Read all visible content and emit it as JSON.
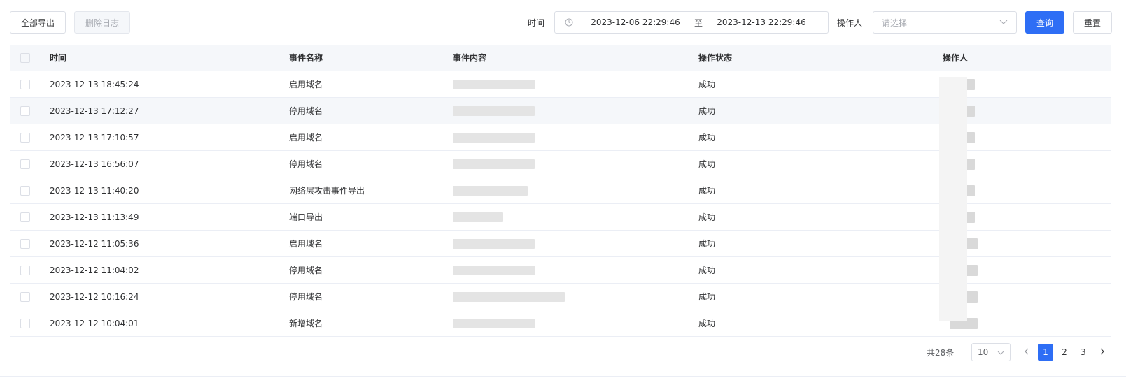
{
  "toolbar": {
    "export_all_label": "全部导出",
    "delete_log_label": "删除日志",
    "time_label": "时间",
    "date_start": "2023-12-06 22:29:46",
    "date_separator": "至",
    "date_end": "2023-12-13 22:29:46",
    "operator_label": "操作人",
    "operator_placeholder": "请选择",
    "query_label": "查询",
    "reset_label": "重置"
  },
  "table": {
    "headers": {
      "time": "时间",
      "event_name": "事件名称",
      "event_content": "事件内容",
      "status": "操作状态",
      "operator": "操作人"
    },
    "rows": [
      {
        "time": "2023-12-13 18:45:24",
        "event_name": "启用域名",
        "status": "成功"
      },
      {
        "time": "2023-12-13 17:12:27",
        "event_name": "停用域名",
        "status": "成功"
      },
      {
        "time": "2023-12-13 17:10:57",
        "event_name": "启用域名",
        "status": "成功"
      },
      {
        "time": "2023-12-13 16:56:07",
        "event_name": "停用域名",
        "status": "成功"
      },
      {
        "time": "2023-12-13 11:40:20",
        "event_name": "网络层攻击事件导出",
        "status": "成功"
      },
      {
        "time": "2023-12-13 11:13:49",
        "event_name": "端口导出",
        "status": "成功"
      },
      {
        "time": "2023-12-12 11:05:36",
        "event_name": "启用域名",
        "status": "成功"
      },
      {
        "time": "2023-12-12 11:04:02",
        "event_name": "停用域名",
        "status": "成功"
      },
      {
        "time": "2023-12-12 10:16:24",
        "event_name": "停用域名",
        "status": "成功"
      },
      {
        "time": "2023-12-12 10:04:01",
        "event_name": "新增域名",
        "status": "成功"
      }
    ]
  },
  "pagination": {
    "total_text": "共28条",
    "page_size": "10",
    "pages": [
      "1",
      "2",
      "3"
    ],
    "current_page": "1"
  },
  "colors": {
    "primary": "#2e6ef5",
    "header_bg": "#f5f7fa",
    "border": "#dcdfe6"
  },
  "icons": {
    "date": "clock-icon",
    "select": "chevron-down-icon",
    "prev": "chevron-left-icon",
    "next": "chevron-right-icon"
  }
}
